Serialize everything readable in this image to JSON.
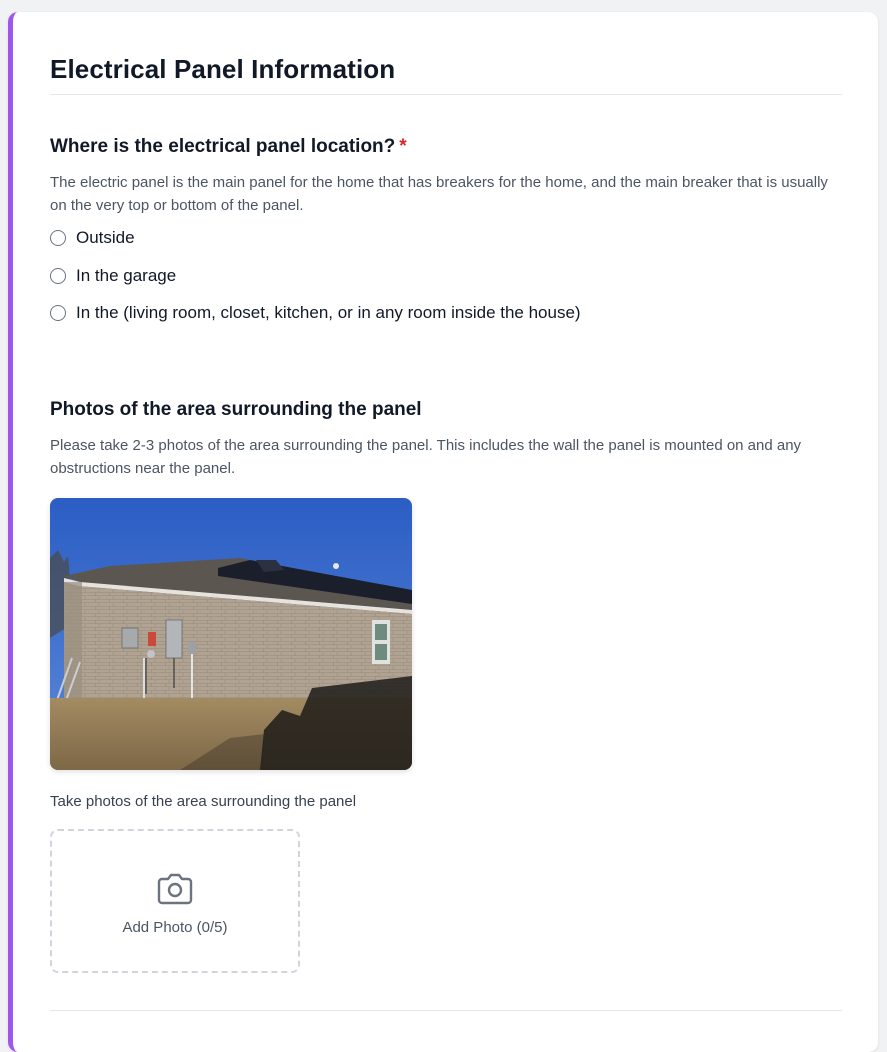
{
  "section": {
    "title": "Electrical Panel Information"
  },
  "panel_location": {
    "label": "Where is the electrical panel location?",
    "required_mark": "*",
    "description": "The electric panel is the main panel for the home that has breakers for the home, and the main breaker that is usually on the very top or bottom of the panel.",
    "options": [
      "Outside",
      "In the garage",
      "In the (living room, closet, kitchen, or in any room inside the house)"
    ]
  },
  "surrounding_photos": {
    "label": "Photos of the area surrounding the panel",
    "description": "Please take 2-3 photos of the area surrounding the panel. This includes the wall the panel is mounted on and any obstructions near the panel.",
    "hint": "Take photos of the area surrounding the panel",
    "add_photo_label": "Add Photo (0/5)",
    "add_photo_icon": "camera-icon"
  },
  "colors": {
    "accent": "#a155ef",
    "required": "#dc2626"
  }
}
